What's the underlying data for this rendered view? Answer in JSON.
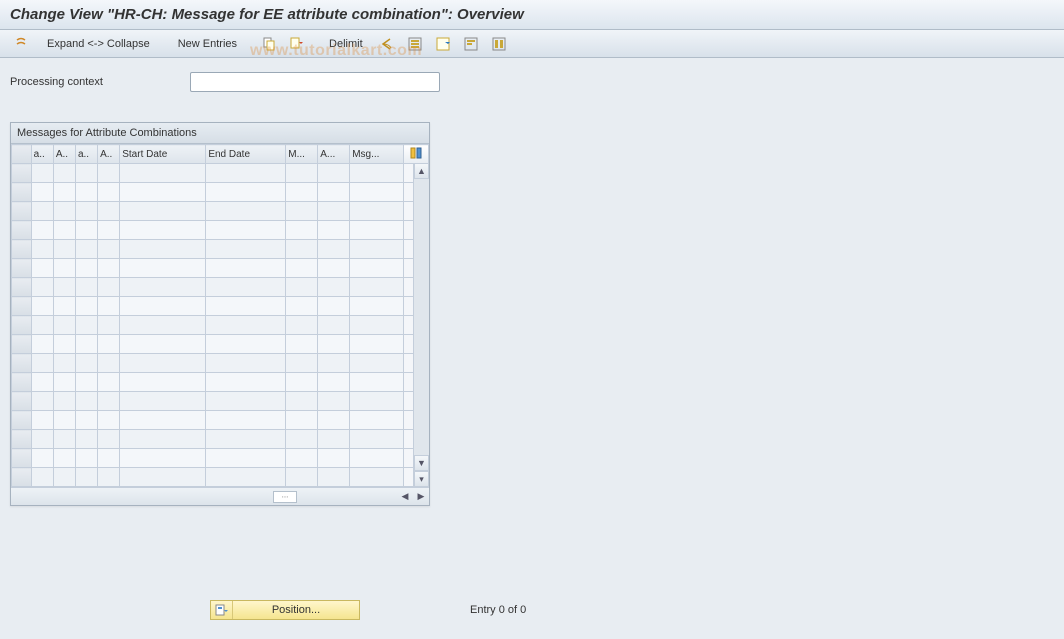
{
  "title": "Change View \"HR-CH: Message for EE attribute combination\": Overview",
  "toolbar": {
    "expand_collapse": "Expand <-> Collapse",
    "new_entries": "New Entries",
    "delimit": "Delimit"
  },
  "field": {
    "processing_context_label": "Processing context",
    "processing_context_value": ""
  },
  "table": {
    "title": "Messages for Attribute Combinations",
    "columns": {
      "c1": "a..",
      "c2": "A..",
      "c3": "a..",
      "c4": "A..",
      "c5": "Start Date",
      "c6": "End Date",
      "c7": "M...",
      "c8": "A...",
      "c9": "Msg..."
    },
    "row_count": 17
  },
  "footer": {
    "position_label": "Position...",
    "entry_text": "Entry 0 of 0"
  },
  "watermark": "www.tutorialkart.com"
}
